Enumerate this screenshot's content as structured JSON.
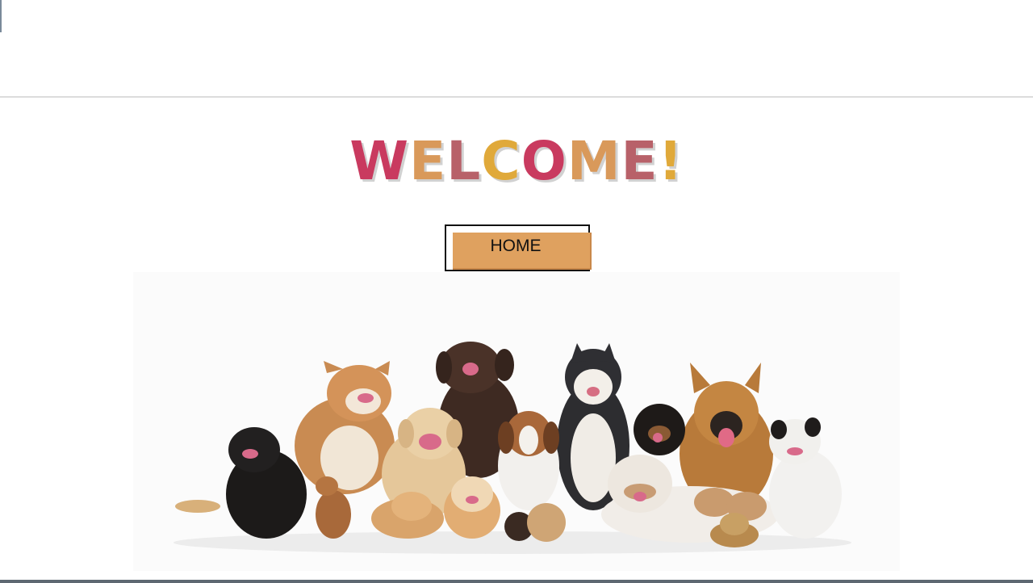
{
  "header": {
    "welcome_text": "WELCOME!"
  },
  "welcome_letters": [
    {
      "char": "W",
      "color": "#c93a5f"
    },
    {
      "char": "E",
      "color": "#d9995a"
    },
    {
      "char": "L",
      "color": "#b86169"
    },
    {
      "char": "C",
      "color": "#e0a93a"
    },
    {
      "char": "O",
      "color": "#c93a5f"
    },
    {
      "char": "M",
      "color": "#d9995a"
    },
    {
      "char": "E",
      "color": "#b86169"
    },
    {
      "char": "!",
      "color": "#e0a93a"
    }
  ],
  "nav": {
    "home_label": "HOME"
  },
  "colors": {
    "home_button": "#dfa15f",
    "welcome_pink": "#c93a5f",
    "welcome_tan": "#d9995a",
    "welcome_mauve": "#b86169",
    "welcome_gold": "#e0a93a"
  },
  "hero_image": {
    "icon": "dogs-group-photo"
  }
}
